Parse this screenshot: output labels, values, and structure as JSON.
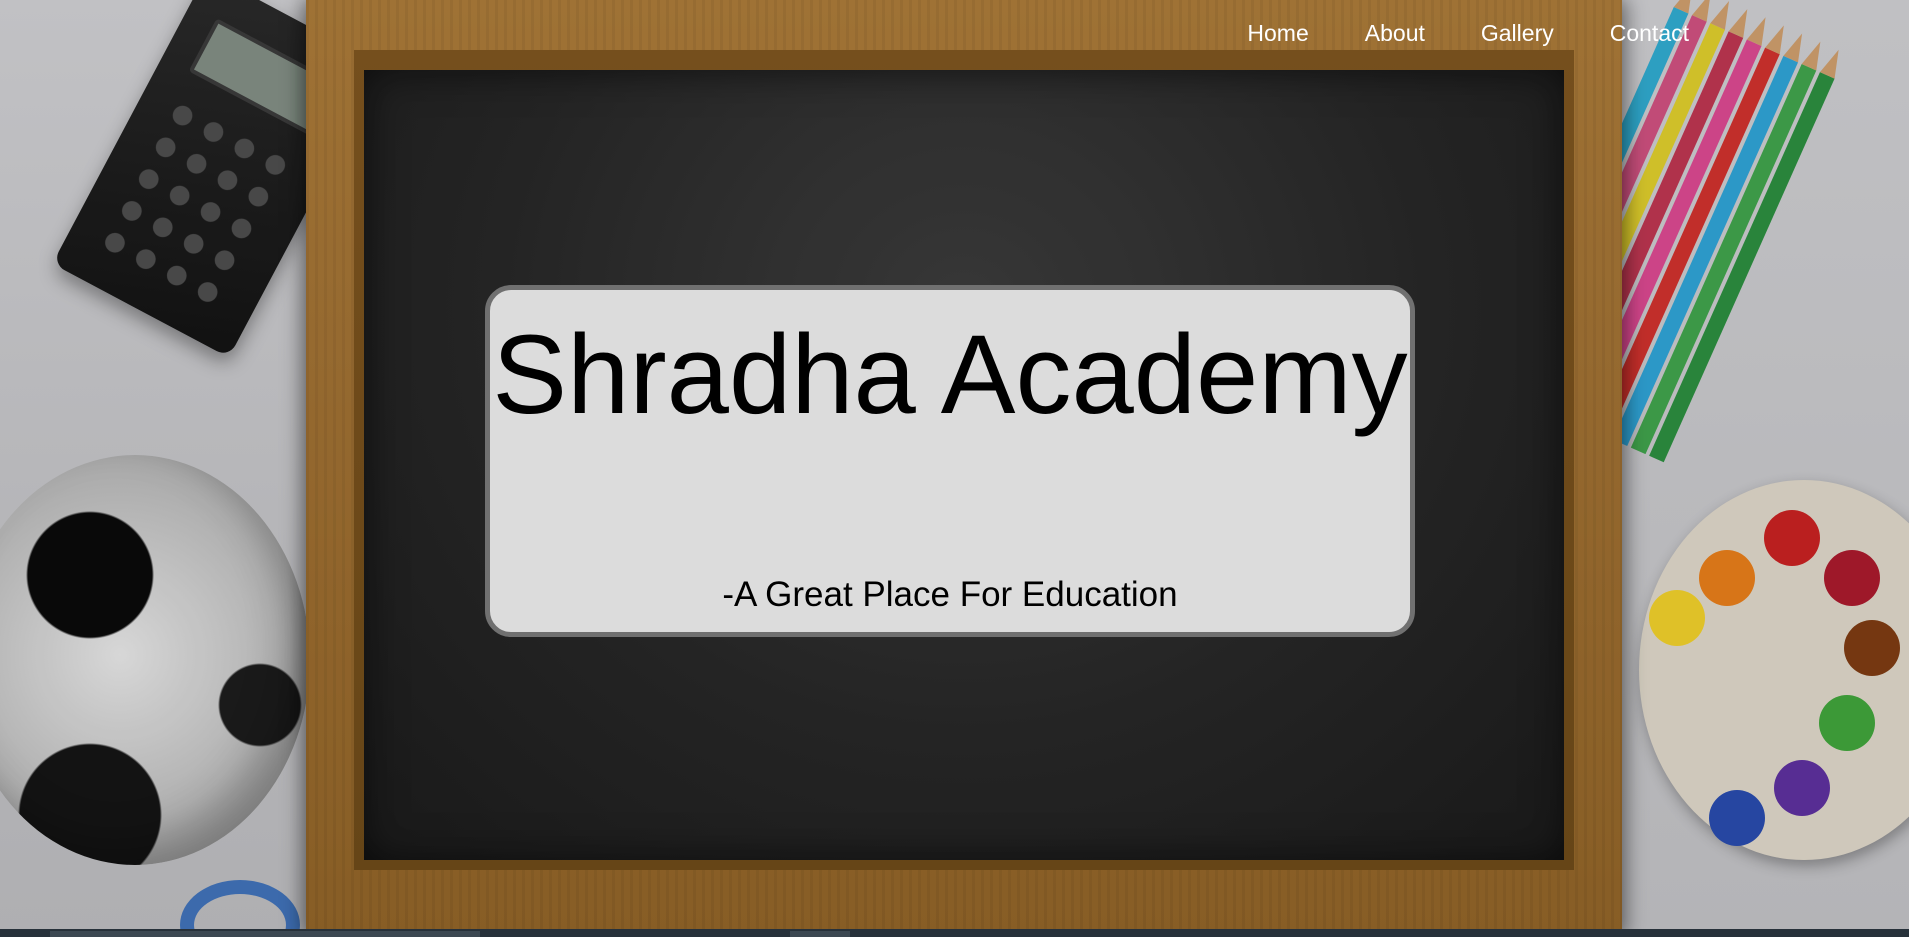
{
  "nav": {
    "items": [
      {
        "label": "Home"
      },
      {
        "label": "About"
      },
      {
        "label": "Gallery"
      },
      {
        "label": "Contact"
      }
    ]
  },
  "hero": {
    "title": "Shradha Academy",
    "subtitle": "-A Great Place For Education"
  },
  "colors": {
    "nav_text": "#ffffff",
    "card_background": "#dcdcdc",
    "card_border": "#707070",
    "board": "#262626",
    "frame": "#9a6c2f"
  }
}
